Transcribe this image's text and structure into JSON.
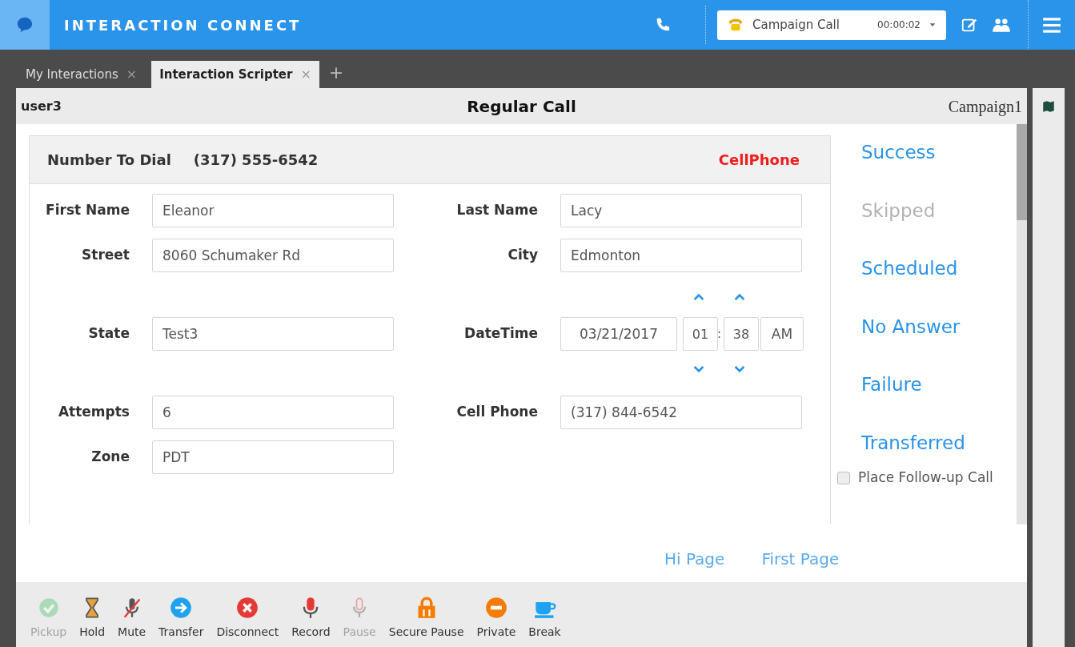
{
  "app": {
    "title": "INTERACTION CONNECT",
    "call": {
      "name": "Campaign Call",
      "timer": "00:00:02"
    }
  },
  "tabs": [
    {
      "label": "My Interactions",
      "close": "×",
      "selected": false
    },
    {
      "label": "Interaction Scripter",
      "close": "×",
      "selected": true
    }
  ],
  "add_tab": "+",
  "header": {
    "user": "user3",
    "title": "Regular Call",
    "campaign": "Campaign1"
  },
  "dial": {
    "label": "Number To Dial",
    "number": "(317) 555-6542",
    "type": "CellPhone"
  },
  "form_rows": [
    [
      {
        "label": "First Name",
        "value": "Eleanor"
      },
      {
        "label": "Last Name",
        "value": "Lacy"
      }
    ],
    [
      {
        "label": "Street",
        "value": "8060 Schumaker Rd"
      },
      {
        "label": "City",
        "value": "Edmonton"
      }
    ],
    [
      {
        "label": "State",
        "value": "Test3"
      },
      {
        "label": "DateTime",
        "kind": "datetime",
        "date": "03/21/2017",
        "hour": "01",
        "separator": ":",
        "minute": "38",
        "ampm": "AM"
      }
    ],
    [
      {
        "label": "Attempts",
        "value": "6"
      },
      {
        "label": "Cell Phone",
        "value": "(317) 844-6542"
      }
    ],
    [
      {
        "label": "Zone",
        "value": "PDT"
      }
    ]
  ],
  "dispositions": [
    {
      "label": "Success",
      "disabled": false
    },
    {
      "label": "Skipped",
      "disabled": true
    },
    {
      "label": "Scheduled",
      "disabled": false
    },
    {
      "label": "No Answer",
      "disabled": false
    },
    {
      "label": "Failure",
      "disabled": false
    },
    {
      "label": "Transferred",
      "disabled": false
    }
  ],
  "follow_up": {
    "label": "Place Follow-up Call",
    "checked": false
  },
  "page_links": [
    "Hi Page",
    "First Page"
  ],
  "toolbar": [
    {
      "kind": "pickup",
      "label": "Pickup",
      "disabled": true
    },
    {
      "kind": "hold",
      "label": "Hold",
      "disabled": false
    },
    {
      "kind": "mute",
      "label": "Mute",
      "disabled": false
    },
    {
      "kind": "transfer",
      "label": "Transfer",
      "disabled": false
    },
    {
      "kind": "disconnect",
      "label": "Disconnect",
      "disabled": false
    },
    {
      "kind": "record",
      "label": "Record",
      "disabled": false
    },
    {
      "kind": "pause",
      "label": "Pause",
      "disabled": true
    },
    {
      "kind": "secure",
      "label": "Secure Pause",
      "disabled": false
    },
    {
      "kind": "private",
      "label": "Private",
      "disabled": false
    },
    {
      "kind": "break",
      "label": "Break",
      "disabled": false
    }
  ]
}
